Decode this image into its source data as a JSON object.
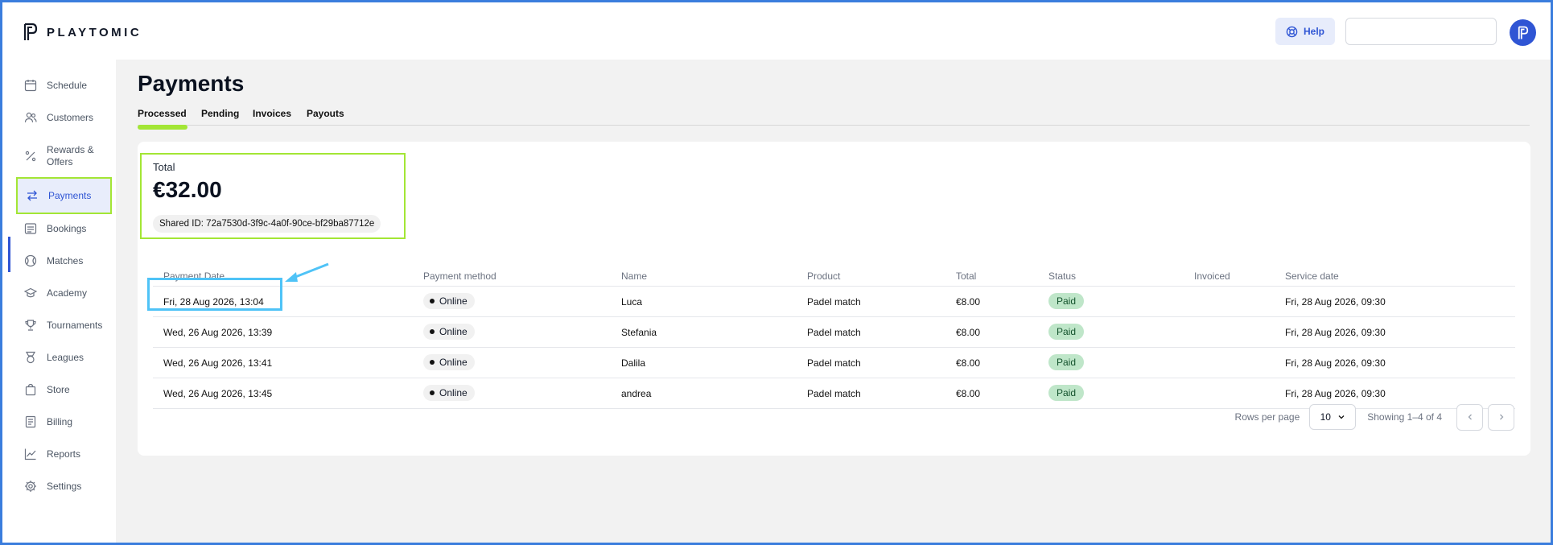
{
  "app": {
    "brand": "PLAYTOMIC"
  },
  "header": {
    "help_label": "Help",
    "search_placeholder": ""
  },
  "sidebar": {
    "items": [
      {
        "label": "Schedule",
        "icon": "calendar-icon"
      },
      {
        "label": "Customers",
        "icon": "users-icon"
      },
      {
        "label": "Rewards &\nOffers",
        "icon": "percent-icon"
      },
      {
        "label": "Payments",
        "icon": "arrows-swap-icon",
        "active": true
      },
      {
        "label": "Bookings",
        "icon": "list-icon"
      },
      {
        "label": "Matches",
        "icon": "ball-icon"
      },
      {
        "label": "Academy",
        "icon": "graduation-cap-icon"
      },
      {
        "label": "Tournaments",
        "icon": "trophy-icon"
      },
      {
        "label": "Leagues",
        "icon": "medal-icon"
      },
      {
        "label": "Store",
        "icon": "bag-icon"
      },
      {
        "label": "Billing",
        "icon": "document-icon"
      },
      {
        "label": "Reports",
        "icon": "chart-line-icon"
      },
      {
        "label": "Settings",
        "icon": "gear-icon"
      }
    ]
  },
  "page": {
    "title": "Payments",
    "tabs": [
      {
        "label": "Processed",
        "active": true
      },
      {
        "label": "Pending"
      },
      {
        "label": "Invoices"
      },
      {
        "label": "Payouts"
      }
    ]
  },
  "summary": {
    "total_label": "Total",
    "total_value": "€32.00",
    "shared_id": "Shared ID: 72a7530d-3f9c-4a0f-90ce-bf29ba87712e"
  },
  "table": {
    "columns": [
      "Payment Date",
      "Payment method",
      "Name",
      "Product",
      "Total",
      "Status",
      "Invoiced",
      "Service date"
    ],
    "rows": [
      {
        "payment_date": "Fri, 28 Aug 2026, 13:04",
        "method": "Online",
        "name": "Luca",
        "product": "Padel match",
        "total": "€8.00",
        "status": "Paid",
        "invoiced": "",
        "service_date": "Fri, 28 Aug 2026, 09:30"
      },
      {
        "payment_date": "Wed, 26 Aug 2026, 13:39",
        "method": "Online",
        "name": "Stefania",
        "product": "Padel match",
        "total": "€8.00",
        "status": "Paid",
        "invoiced": "",
        "service_date": "Fri, 28 Aug 2026, 09:30"
      },
      {
        "payment_date": "Wed, 26 Aug 2026, 13:41",
        "method": "Online",
        "name": "Dalila",
        "product": "Padel match",
        "total": "€8.00",
        "status": "Paid",
        "invoiced": "",
        "service_date": "Fri, 28 Aug 2026, 09:30"
      },
      {
        "payment_date": "Wed, 26 Aug 2026, 13:45",
        "method": "Online",
        "name": "andrea",
        "product": "Padel match",
        "total": "€8.00",
        "status": "Paid",
        "invoiced": "",
        "service_date": "Fri, 28 Aug 2026, 09:30"
      }
    ]
  },
  "pagination": {
    "rows_per_page_label": "Rows per page",
    "rows_per_page_value": "10",
    "showing": "Showing 1–4 of 4"
  },
  "colors": {
    "accent": "#2f55d4",
    "highlight_green": "#a3e635",
    "highlight_blue": "#4fc3f7",
    "paid_badge": "#bfe6c9"
  }
}
